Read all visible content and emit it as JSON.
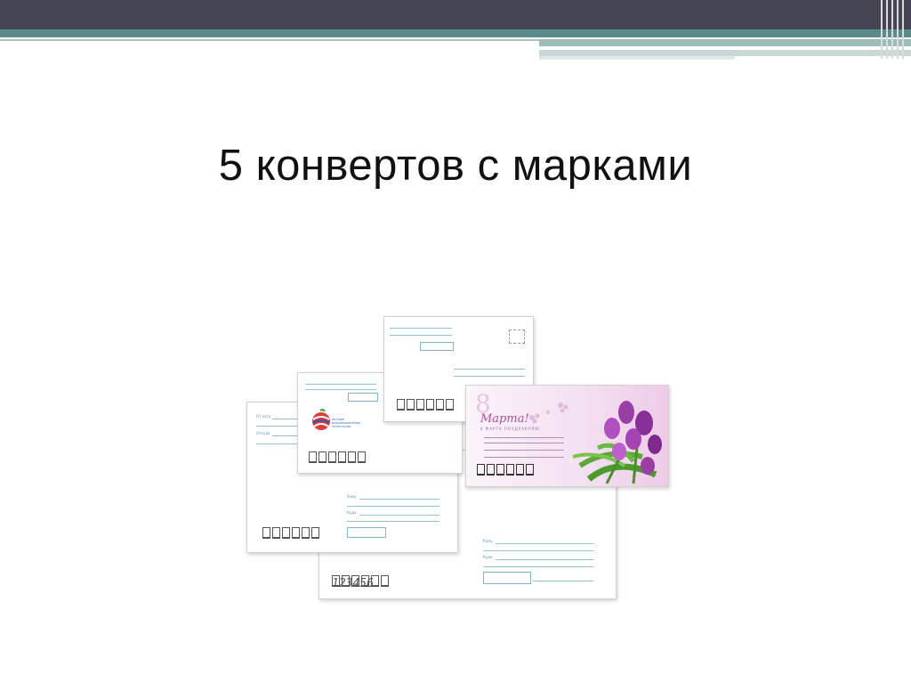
{
  "slide": {
    "title": "5 конвертов с марками"
  },
  "envelopes": {
    "marta_label": "Марта!",
    "marta_sub": "8 МАРТА ПОЗДРАВЛЯЮ",
    "logo_text": "РУССКИЕ ИНФОРМАЦИОННЫЕ ТЕХНОЛОГИИ",
    "postcode_digits": "123456"
  },
  "colors": {
    "topbar": "#454554",
    "accent_teal": "#5b8c8c",
    "envelope_lines": "#8ec3e6",
    "tulip_purple": "#9a3fa8"
  }
}
